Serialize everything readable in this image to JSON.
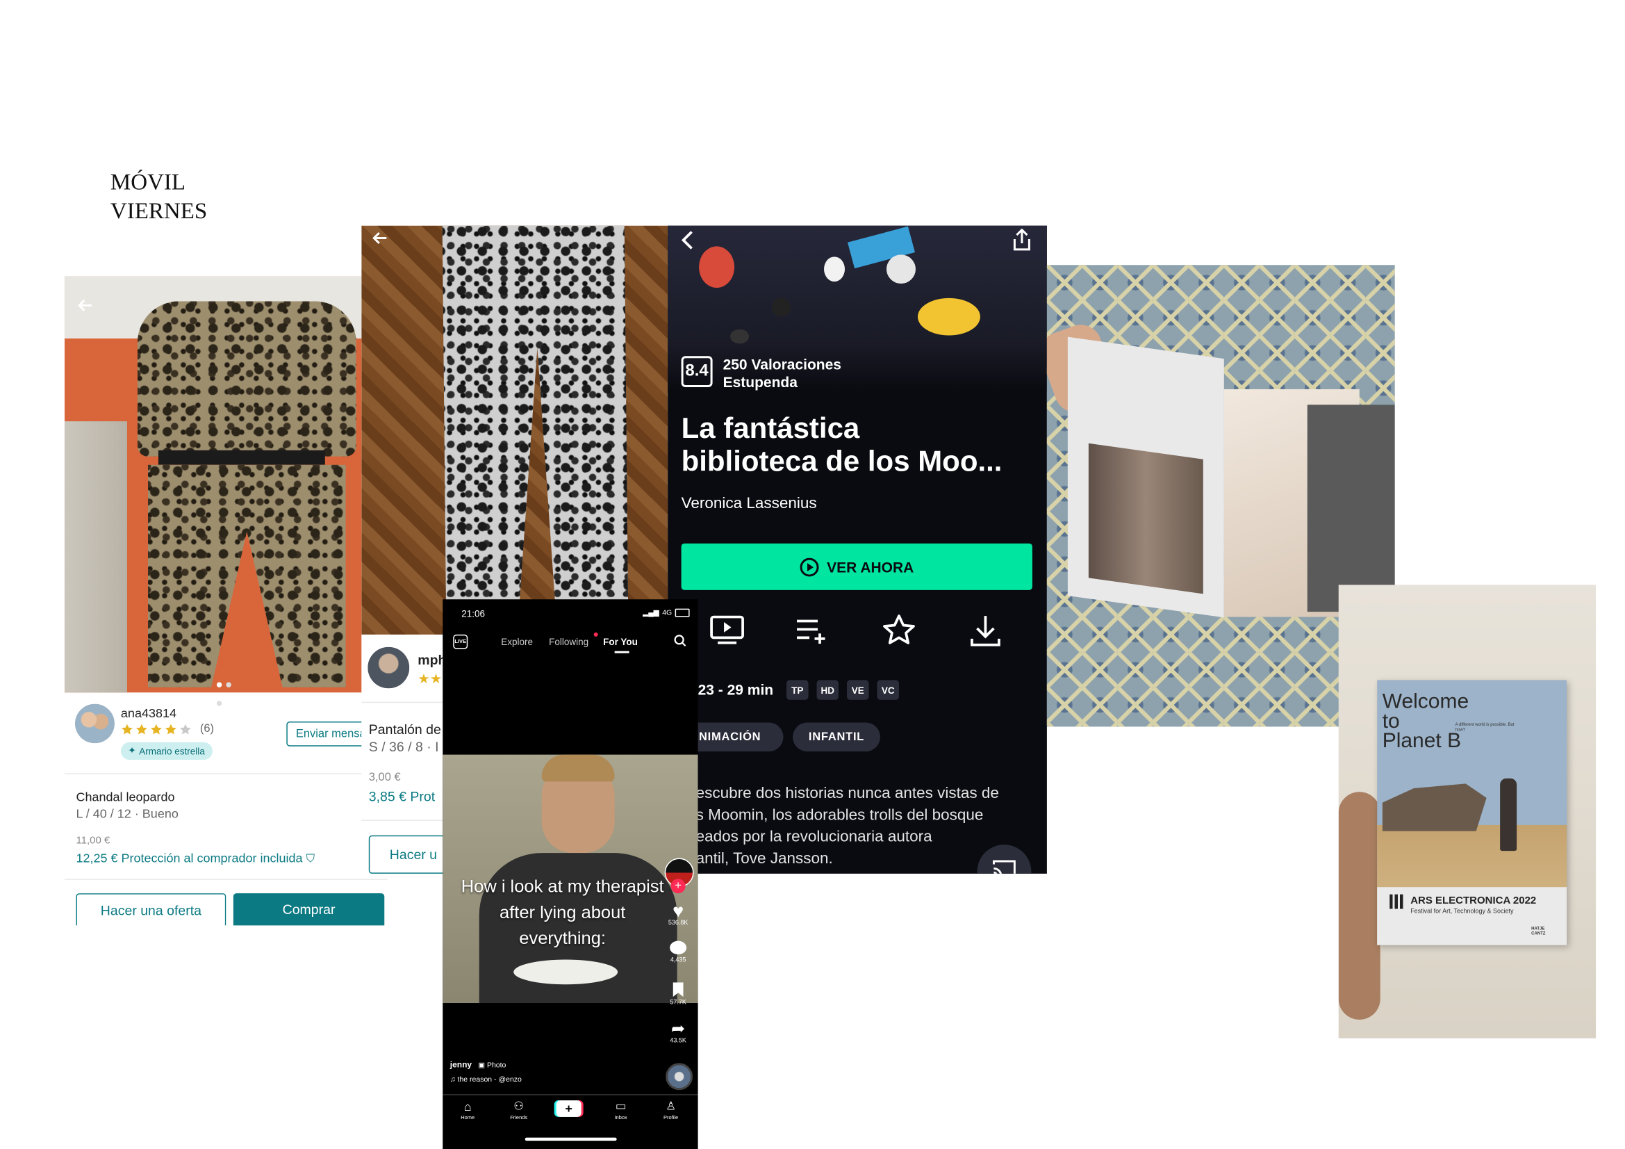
{
  "heading": {
    "line1": "MÓVIL",
    "line2": "VIERNES"
  },
  "vinted1": {
    "seller": "ana43814",
    "reviews": "(6)",
    "badge": "Armario estrella",
    "message_button": "Enviar mensa",
    "title": "Chandal leopardo",
    "details": "L / 40 / 12 · Bueno",
    "price": "11,00 €",
    "total": "12,25 €",
    "protection": "Protección al comprador incluida",
    "offer_button": "Hacer una oferta",
    "buy_button": "Comprar",
    "rating_fraction": 0.8
  },
  "vinted2": {
    "seller": "mph",
    "title": "Pantalón de",
    "details": "S / 36 / 8 · I",
    "price": "3,00 €",
    "total": "3,85 €",
    "protection": "Prot",
    "offer_button": "Hacer u"
  },
  "movie": {
    "score": "8.4",
    "ratings": "250 Valoraciones",
    "verdict": "Estupenda",
    "title_line1": "La fantástica",
    "title_line2": "biblioteca de los Moo...",
    "director": "Veronica Lassenius",
    "watch_button": "VER AHORA",
    "meta": "23 - 29 min",
    "badges": [
      "TP",
      "HD",
      "VE",
      "VC"
    ],
    "tags": [
      "ANIMACIÓN",
      "INFANTIL"
    ],
    "synopsis": [
      "escubre dos historias nunca antes vistas de",
      "s Moomin, los adorables trolls del bosque",
      "eados por la revolucionaria autora",
      "antil, Tove Jansson."
    ],
    "accent": "#00e6a0"
  },
  "tiktok": {
    "time": "21:06",
    "network": "4G",
    "tabs": [
      "Explore",
      "Following",
      "For You"
    ],
    "caption": [
      "How i look at my therapist",
      "after lying about",
      "everything:"
    ],
    "likes": "536.8K",
    "comments": "4,435",
    "saves": "57.7K",
    "shares": "43.5K",
    "user": "jenny",
    "post_type": "Photo",
    "sound": "the reason - @enzo",
    "nav": [
      "Home",
      "Friends",
      "Inbox",
      "Profile"
    ]
  },
  "book": {
    "title_line1": "Welcome",
    "title_line2": "to",
    "title_line3": "Planet B",
    "tagline": "A different world is possible. But how?",
    "event": "ARS ELECTRONICA 2022",
    "subtitle": "Festival for Art, Technology & Society",
    "publisher": "HATJE CANTZ"
  }
}
